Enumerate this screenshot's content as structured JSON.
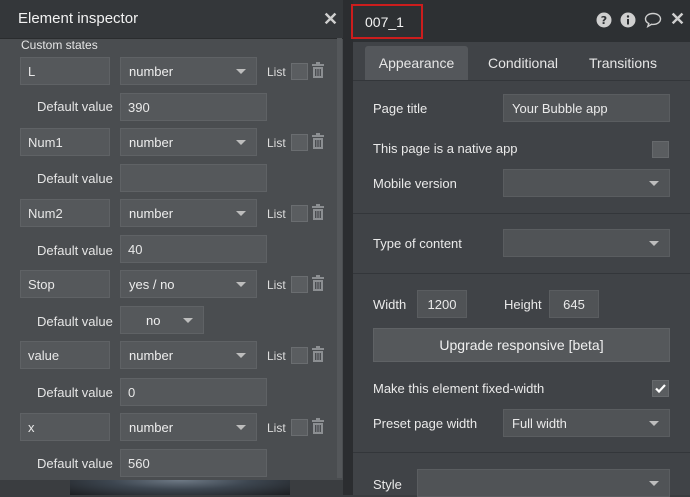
{
  "left": {
    "title": "Element inspector",
    "section": "Custom states",
    "list_label": "List",
    "default_value_label": "Default value",
    "states": [
      {
        "name": "L",
        "type": "number",
        "default": "390"
      },
      {
        "name": "Num1",
        "type": "number",
        "default": ""
      },
      {
        "name": "Num2",
        "type": "number",
        "default": "40"
      },
      {
        "name": "Stop",
        "type": "yes / no",
        "default": "no"
      },
      {
        "name": "value",
        "type": "number",
        "default": "0"
      },
      {
        "name": "x",
        "type": "number",
        "default": "560"
      }
    ]
  },
  "right": {
    "element_name": "007_1",
    "tabs": [
      "Appearance",
      "Conditional",
      "Transitions"
    ],
    "page_title_label": "Page title",
    "page_title_value": "Your Bubble app",
    "native_app_label": "This page is a native app",
    "mobile_version_label": "Mobile version",
    "mobile_version_value": "",
    "type_of_content_label": "Type of content",
    "type_of_content_value": "",
    "width_label": "Width",
    "width_value": "1200",
    "height_label": "Height",
    "height_value": "645",
    "upgrade_label": "Upgrade responsive [beta]",
    "fixed_width_label": "Make this element fixed-width",
    "fixed_width_checked": true,
    "preset_label": "Preset page width",
    "preset_value": "Full width",
    "style_label": "Style",
    "style_value": ""
  },
  "icons": {
    "help": "question-circle-icon",
    "info": "info-circle-icon",
    "comment": "comment-icon",
    "close": "close-icon",
    "trash": "trash-icon",
    "checkmark": "checkmark-icon"
  }
}
